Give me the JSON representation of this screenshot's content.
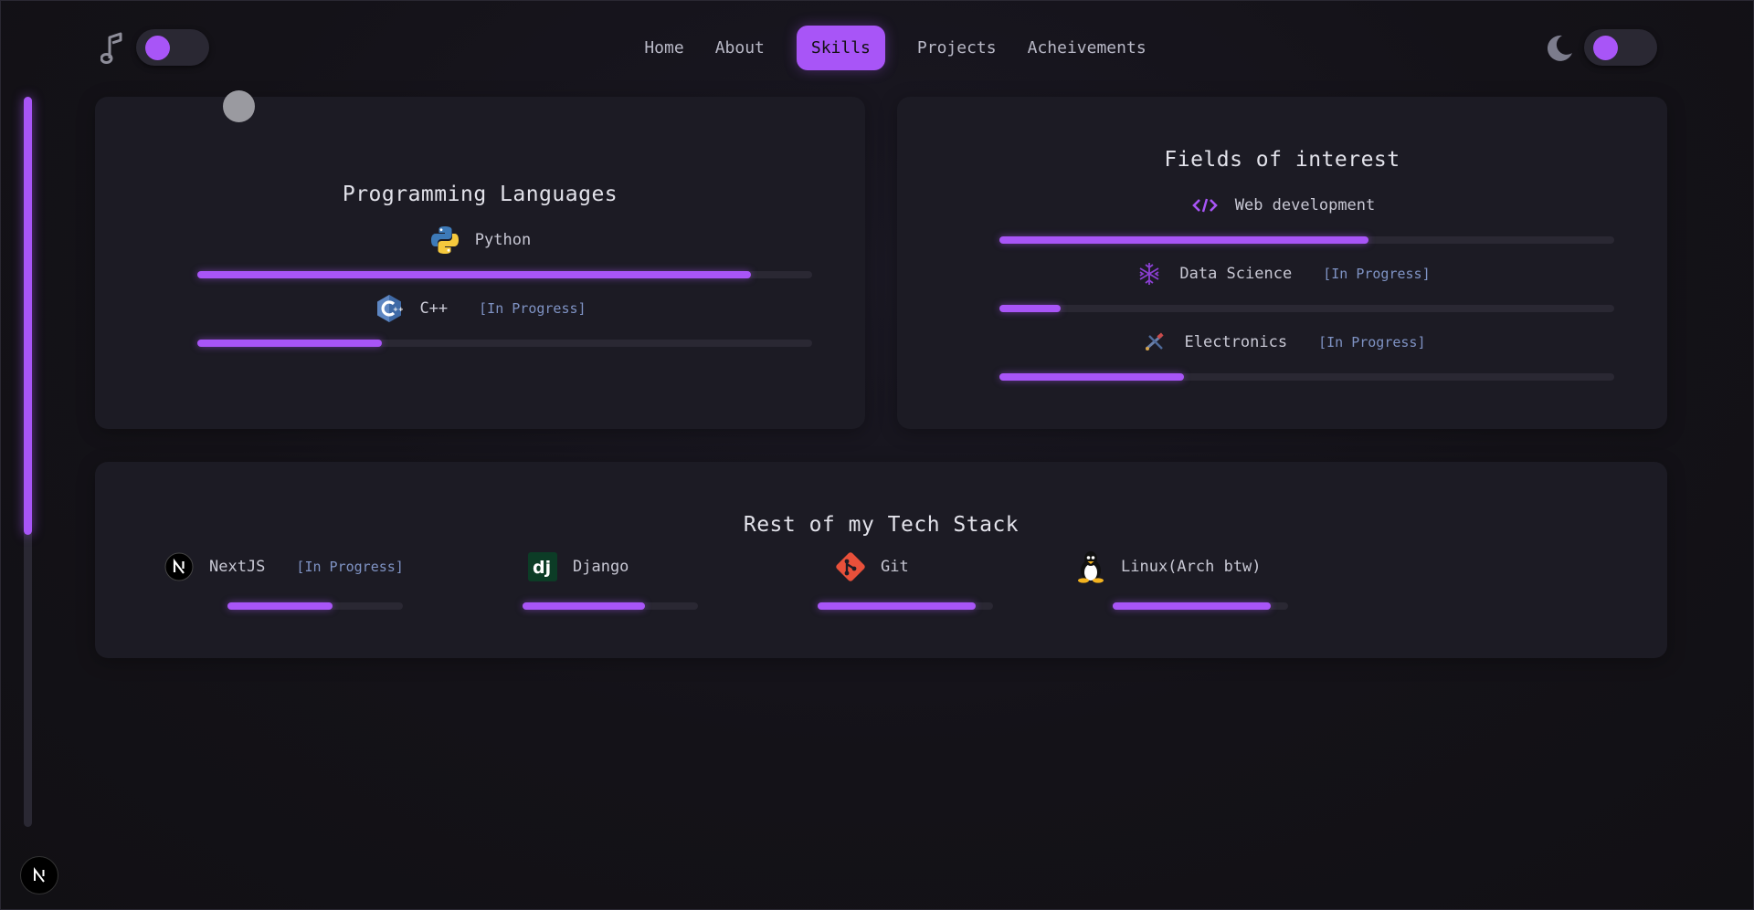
{
  "nav": {
    "items": [
      "Home",
      "About",
      "Skills",
      "Projects",
      "Acheivements"
    ],
    "active": "Skills"
  },
  "colors": {
    "accent": "#a855f7",
    "card": "#1c1b24",
    "track": "#2a2833",
    "tag": "#7f93c4"
  },
  "languages": {
    "title": "Programming Languages",
    "items": [
      {
        "label": "Python",
        "icon": "python-icon",
        "tag": "",
        "progress": 0.9
      },
      {
        "label": "C++",
        "icon": "cpp-icon",
        "tag": "[In Progress]",
        "progress": 0.3
      }
    ]
  },
  "fields": {
    "title": "Fields of interest",
    "items": [
      {
        "label": "Web development",
        "icon": "code-icon",
        "tag": "",
        "progress": 0.6
      },
      {
        "label": "Data Science",
        "icon": "data-science-icon",
        "tag": "[In Progress]",
        "progress": 0.1
      },
      {
        "label": "Electronics",
        "icon": "electronics-icon",
        "tag": "[In Progress]",
        "progress": 0.3
      }
    ]
  },
  "stack": {
    "title": "Rest of my Tech Stack",
    "items": [
      {
        "label": "NextJS",
        "icon": "nextjs-icon",
        "tag": "[In Progress]",
        "progress": 0.6
      },
      {
        "label": "Django",
        "icon": "django-icon",
        "tag": "",
        "progress": 0.7
      },
      {
        "label": "Git",
        "icon": "git-icon",
        "tag": "",
        "progress": 0.9
      },
      {
        "label": "Linux(Arch btw)",
        "icon": "linux-icon",
        "tag": "",
        "progress": 0.9
      }
    ]
  },
  "scroll": {
    "progress": 0.6
  }
}
